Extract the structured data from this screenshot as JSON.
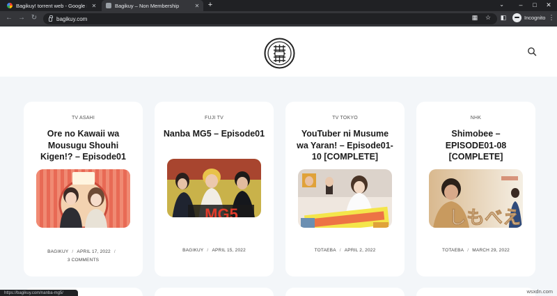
{
  "browser": {
    "tabs": [
      {
        "title": "Bagikuy! torrent web - Google Se",
        "active": false
      },
      {
        "title": "Bagikuy – Non Membership",
        "active": true
      }
    ],
    "new_tab": "+",
    "url": "bagikuy.com",
    "incognito_label": "Incognito",
    "status_url": "https://bagikuy.com/nanba-mg5/"
  },
  "site": {
    "logo": "site-logo"
  },
  "cards": [
    {
      "category": "TV ASAHI",
      "title": "Ore no Kawaii wa Mousugu Shouhi Kigen!? – Episode01",
      "author": "BAGIKUY",
      "date": "APRIL 17, 2022",
      "comments": "3 COMMENTS"
    },
    {
      "category": "FUJI TV",
      "title": "Nanba MG5 – Episode01",
      "author": "BAGIKUY",
      "date": "APRIL 15, 2022"
    },
    {
      "category": "TV TOKYO",
      "title": "YouTuber ni Musume wa Yaran! – Episode01-10 [COMPLETE]",
      "author": "TOTAEBA",
      "date": "APRIL 2, 2022"
    },
    {
      "category": "NHK",
      "title": "Shimobee – EPISODE01-08 [COMPLETE]",
      "author": "TOTAEBA",
      "date": "MARCH 29, 2022"
    }
  ],
  "watermark": "wsxdn.com"
}
